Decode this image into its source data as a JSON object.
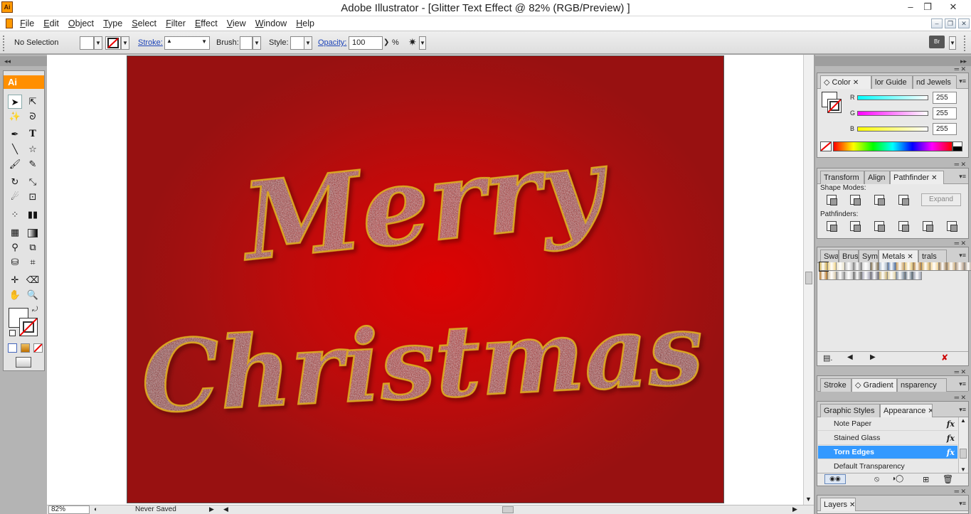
{
  "window": {
    "title": "Adobe Illustrator - [Glitter Text Effect @ 82% (RGB/Preview) ]",
    "app_icon": "Ai",
    "minimize": "–",
    "restore": "❐",
    "close": "✕"
  },
  "menu": [
    "File",
    "Edit",
    "Object",
    "Type",
    "Select",
    "Filter",
    "Effect",
    "View",
    "Window",
    "Help"
  ],
  "control_bar": {
    "selection": "No Selection",
    "stroke_label": "Stroke:",
    "brush_label": "Brush:",
    "style_label": "Style:",
    "opacity_label": "Opacity:",
    "opacity_value": "100",
    "percent": "%"
  },
  "tools_panel": {
    "logo": "Ai"
  },
  "artwork": {
    "line1": "Merry",
    "line2": "Christmas"
  },
  "status_bar": {
    "zoom": "82%",
    "save_state": "Never Saved"
  },
  "color_panel": {
    "tabs": [
      "Color",
      "lor Guide",
      "nd Jewels"
    ],
    "channels": [
      {
        "label": "R",
        "value": "255"
      },
      {
        "label": "G",
        "value": "255"
      },
      {
        "label": "B",
        "value": "255"
      }
    ]
  },
  "pathfinder_panel": {
    "tabs": [
      "Transform",
      "Align",
      "Pathfinder"
    ],
    "shape_modes_label": "Shape Modes:",
    "expand_label": "Expand",
    "pathfinders_label": "Pathfinders:"
  },
  "swatches_panel": {
    "tabs": [
      "Swa",
      "Brus",
      "Sym",
      "Metals",
      "trals"
    ]
  },
  "gradient_panel": {
    "tabs": [
      "Stroke",
      "Gradient",
      "nsparency"
    ]
  },
  "graphic_styles_panel": {
    "tabs": [
      "Graphic Styles",
      "Appearance"
    ],
    "items": [
      {
        "name": "Note Paper",
        "fx": "fx",
        "selected": false
      },
      {
        "name": "Stained Glass",
        "fx": "fx",
        "selected": false
      },
      {
        "name": "Torn Edges",
        "fx": "fx",
        "selected": true
      },
      {
        "name": "Default Transparency",
        "fx": "",
        "selected": false
      }
    ]
  },
  "layers_panel": {
    "tabs": [
      "Layers"
    ]
  },
  "colors": {
    "artboard_red": "#cc0a0a",
    "glitter_gold": "#d9a520",
    "selection_blue": "#3399ff",
    "ai_orange": "#ff8f00"
  }
}
